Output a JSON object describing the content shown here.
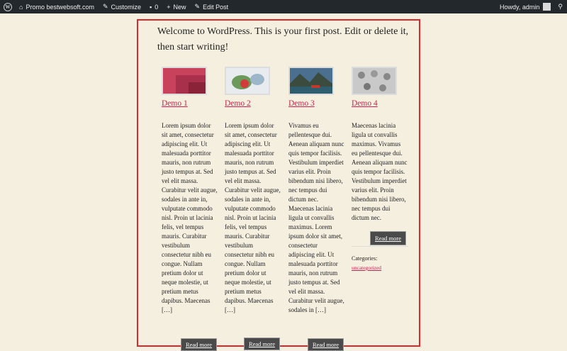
{
  "adminbar": {
    "site": "Promo bestwebsoft.com",
    "customize": "Customize",
    "comments": "0",
    "new": "New",
    "edit": "Edit Post",
    "howdy": "Howdy, admin"
  },
  "post": {
    "intro": "Welcome to WordPress. This is your first post. Edit or delete it, then start writing!"
  },
  "items": [
    {
      "title": "Demo 1",
      "excerpt": "Lorem ipsum dolor sit amet, consectetur adipiscing elit. Ut malesuada porttitor mauris, non rutrum justo tempus at. Sed vel elit massa. Curabitur velit augue, sodales in ante in, vulputate commodo nisl. Proin ut lacinia felis, vel tempus mauris. Curabitur vestibulum consectetur nibh eu congue. Nullam pretium dolor ut neque molestie, ut pretium metus dapibus. Maecenas […]",
      "button": "Read more"
    },
    {
      "title": "Demo 2",
      "excerpt": "Lorem ipsum dolor sit amet, consectetur adipiscing elit. Ut malesuada porttitor mauris, non rutrum justo tempus at. Sed vel elit massa. Curabitur velit augue, sodales in ante in, vulputate commodo nisl. Proin ut lacinia felis, vel tempus mauris. Curabitur vestibulum consectetur nibh eu congue. Nullam pretium dolor ut neque molestie, ut pretium metus dapibus. Maecenas […]",
      "button": "Read more"
    },
    {
      "title": "Demo 3",
      "excerpt": "Vivamus eu pellentesque dui. Aenean aliquam nunc quis tempor facilisis. Vestibulum imperdiet varius elit. Proin bibendum nisi libero, nec tempus dui dictum nec. Maecenas lacinia ligula ut convallis maximus. Lorem ipsum dolor sit amet, consectetur adipiscing elit. Ut malesuada porttitor mauris, non rutrum justo tempus at. Sed vel elit massa. Curabitur velit augue, sodales in […]",
      "button": "Read more"
    },
    {
      "title": "Demo 4",
      "excerpt": "Maecenas lacinia ligula ut convallis maximus. Vivamus eu pellentesque dui. Aenean aliquam nunc quis tempor facilisis. Vestibulum imperdiet varius elit. Proin bibendum nisi libero, nec tempus dui dictum nec.",
      "button": "Read more"
    }
  ],
  "categories": {
    "label": "Categories:",
    "link": "uncategorized"
  }
}
